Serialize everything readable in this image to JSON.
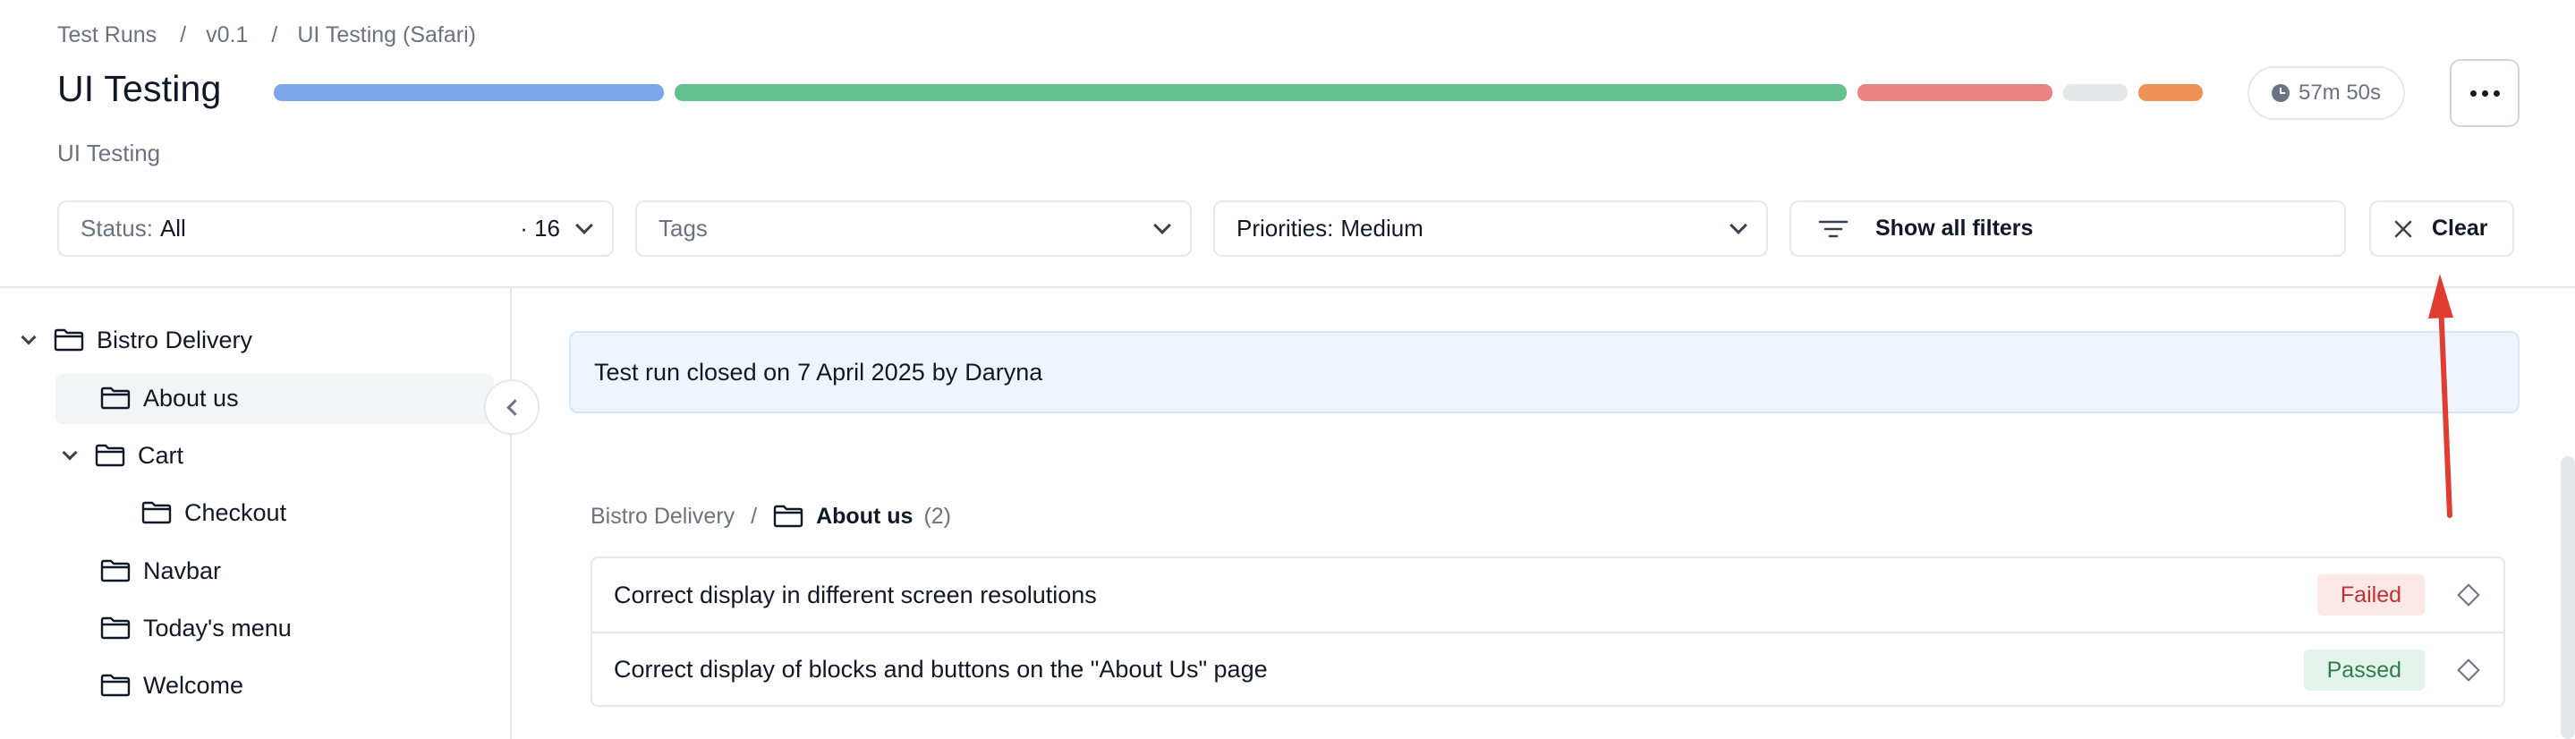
{
  "breadcrumb": [
    "Test Runs",
    "v0.1",
    "UI Testing (Safari)"
  ],
  "title": "UI Testing",
  "subtitle": "UI Testing",
  "progress": {
    "segments": [
      {
        "name": "blue",
        "color": "#7ea6ec",
        "fraction": 0.205
      },
      {
        "name": "green",
        "color": "#63c08f",
        "fraction": 0.616
      },
      {
        "name": "red",
        "color": "#e88583",
        "fraction": 0.102
      },
      {
        "name": "gray",
        "color": "#e5e7eb",
        "fraction": 0.035
      },
      {
        "name": "orange",
        "color": "#ee9258",
        "fraction": 0.034
      }
    ]
  },
  "timer": "57m 50s",
  "filters": {
    "status_label": "Status:",
    "status_value": "All",
    "status_count": "· 16",
    "tags_placeholder": "Tags",
    "priorities_label": "Priorities:",
    "priorities_value": "Medium",
    "show_all": "Show all filters",
    "clear": "Clear"
  },
  "tree": {
    "root": "Bistro Delivery",
    "items": [
      {
        "label": "About us"
      },
      {
        "label": "Cart"
      },
      {
        "label": "Checkout"
      },
      {
        "label": "Navbar"
      },
      {
        "label": "Today's menu"
      },
      {
        "label": "Welcome"
      }
    ]
  },
  "banner": {
    "prefix": "Test run closed on",
    "date": "7 April 2025",
    "by": "by",
    "user": "Daryna"
  },
  "path": {
    "parent": "Bistro Delivery",
    "sep": "/",
    "current": "About us",
    "count": "(2)"
  },
  "cases": [
    {
      "title": "Correct display in different screen resolutions",
      "status": "Failed"
    },
    {
      "title": "Correct display of blocks and buttons on the \"About Us\" page",
      "status": "Passed"
    }
  ],
  "colors": {
    "annotation_arrow": "#e03c31",
    "banner_bg": "#eef5fd"
  }
}
